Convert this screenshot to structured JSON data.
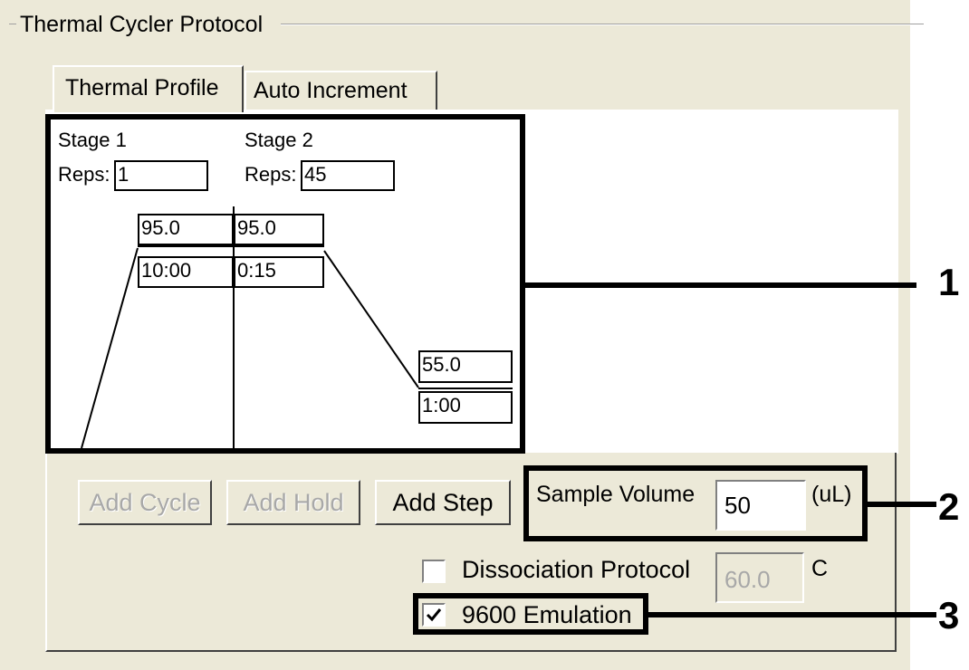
{
  "window": {
    "group_title": "Thermal Cycler Protocol"
  },
  "tabs": [
    {
      "label": "Thermal Profile",
      "active": true
    },
    {
      "label": "Auto Increment",
      "active": false
    }
  ],
  "profile": {
    "stages": [
      {
        "label": "Stage 1",
        "reps_label": "Reps:",
        "reps": "1",
        "steps": [
          {
            "temp": "95.0",
            "time": "10:00"
          }
        ]
      },
      {
        "label": "Stage 2",
        "reps_label": "Reps:",
        "reps": "45",
        "steps": [
          {
            "temp": "95.0",
            "time": "0:15"
          },
          {
            "temp": "55.0",
            "time": "1:00"
          }
        ]
      }
    ]
  },
  "buttons": {
    "add_cycle": "Add Cycle",
    "add_hold": "Add Hold",
    "add_step": "Add Step"
  },
  "sample_volume": {
    "label": "Sample Volume",
    "value": "50",
    "unit": "(uL)"
  },
  "dissociation": {
    "label": "Dissociation Protocol",
    "checked": false,
    "value": "60.0",
    "unit": "C"
  },
  "emulation": {
    "label": "9600 Emulation",
    "checked": true
  },
  "callouts": [
    "1",
    "2",
    "3"
  ]
}
